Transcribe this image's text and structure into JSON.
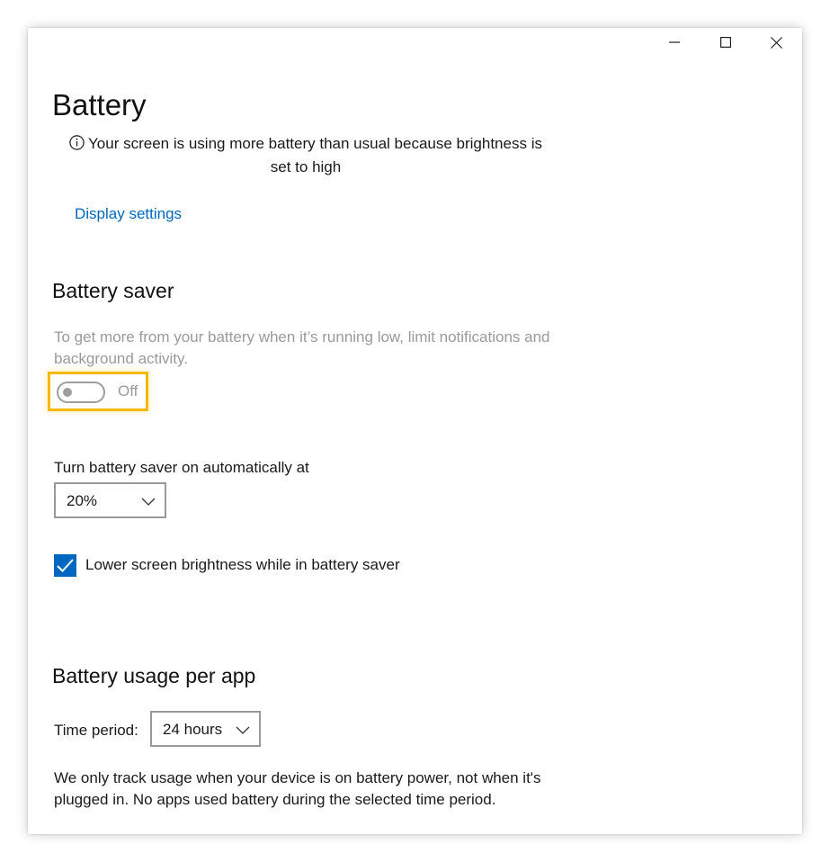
{
  "window": {
    "caption_buttons": [
      "minimize-icon",
      "maximize-icon",
      "close-icon"
    ]
  },
  "page": {
    "title": "Battery"
  },
  "notice": {
    "icon": "info-icon",
    "text": "Your screen is using more battery than usual because brightness is set to high"
  },
  "display_settings_link": "Display settings",
  "battery_saver": {
    "title": "Battery saver",
    "description": "To get more from your battery when it’s running low, limit notifications and background activity.",
    "toggle_state": "Off",
    "toggle_on": false,
    "auto_label": "Turn battery saver on automatically at",
    "threshold_value": "20%",
    "brightness_checkbox_label": "Lower screen brightness while in battery saver",
    "brightness_checkbox_checked": true
  },
  "usage": {
    "title": "Battery usage per app",
    "time_period_label": "Time period:",
    "time_period_value": "24 hours",
    "footnote": "We only track usage when your device is on battery power, not when it's plugged in. No apps used battery during the selected time period."
  },
  "colors": {
    "accent": "#0067c0",
    "highlight": "#f5b800",
    "disabled_text": "#9a9a9a"
  }
}
